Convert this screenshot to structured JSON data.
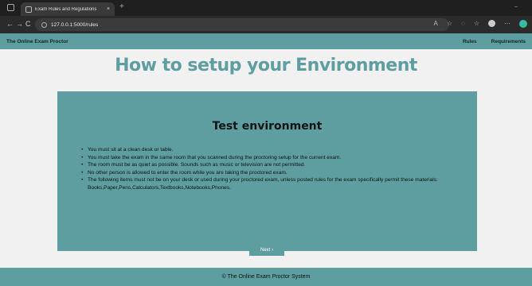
{
  "browser": {
    "tab_title": "Exam Rules and Regulations",
    "tab_close": "×",
    "new_tab": "+",
    "url": "127.0.0.1:5000/rules",
    "back": "←",
    "forward": "→",
    "reload": "C",
    "minimize": "−"
  },
  "navbar": {
    "brand": "The Online Exam Proctor",
    "links": [
      "Rules",
      "Requirements"
    ]
  },
  "page": {
    "heading": "How to setup your Environment",
    "panel_title": "Test environment",
    "rules": [
      "You must sit at a clean desk or table.",
      "You must take the exam in the same room that you scanned during the proctoring setup for the current exam.",
      "The room must be as quiet as possible. Sounds such as music or television are not permitted.",
      "No other person is allowed to enter the room while you are taking the proctored exam.",
      "The following items must not be on your desk or used during your proctored exam, unless posted rules for the exam specifically permit these materials: Books,Paper,Pens,Calculators,Textbooks,Notebooks,Phones."
    ],
    "next_label": "Next ›"
  },
  "footer": {
    "text": "© The Online Exam Proctor System"
  },
  "colors": {
    "accent": "#5f9ea0",
    "background": "#f1f1f1"
  }
}
